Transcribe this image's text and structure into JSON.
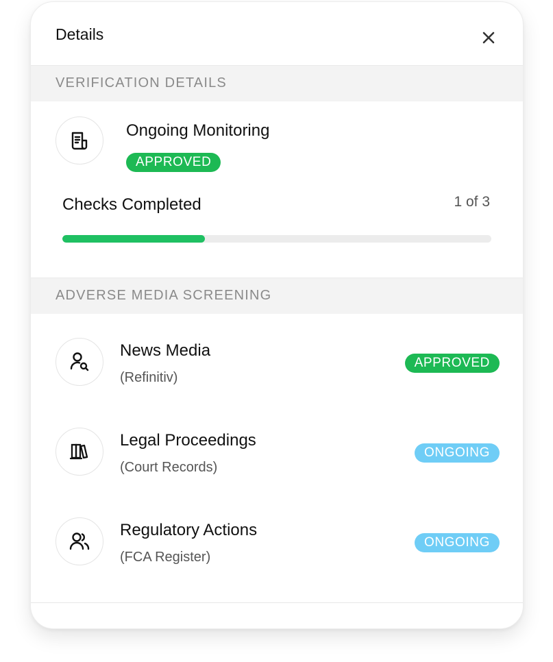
{
  "panel": {
    "title": "Details",
    "close_icon": "close-icon"
  },
  "verification": {
    "section_label": "VERIFICATION DETAILS",
    "item": {
      "icon": "document-icon",
      "title": "Ongoing Monitoring",
      "status": "APPROVED"
    },
    "checks": {
      "label": "Checks Completed",
      "count_text": "1 of 3",
      "progress_fraction": 0.333
    }
  },
  "adverse_media": {
    "section_label": "ADVERSE MEDIA SCREENING",
    "items": [
      {
        "icon": "user-search-icon",
        "title": "News Media",
        "source": "(Refinitiv)",
        "status": "APPROVED",
        "status_color": "#1db954"
      },
      {
        "icon": "books-icon",
        "title": "Legal Proceedings",
        "source": "(Court Records)",
        "status": "ONGOING",
        "status_color": "#6fcdf6"
      },
      {
        "icon": "users-icon",
        "title": "Regulatory Actions",
        "source": "(FCA Register)",
        "status": "ONGOING",
        "status_color": "#6fcdf6"
      }
    ]
  },
  "colors": {
    "approved": "#1db954",
    "ongoing": "#6fcdf6",
    "progress": "#1fc062"
  }
}
